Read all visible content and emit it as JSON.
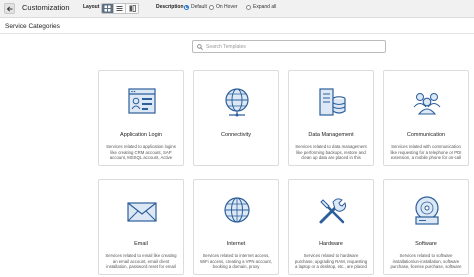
{
  "header": {
    "back_icon": "arrow-left-icon",
    "title": "Customization",
    "layout_label": "Layout",
    "layout_options": [
      {
        "icon": "grid-icon",
        "active": true
      },
      {
        "icon": "list-icon",
        "active": false
      },
      {
        "icon": "split-view-icon",
        "active": false
      }
    ],
    "description_label": "Description",
    "description_options": [
      {
        "label": "Default",
        "checked": true
      },
      {
        "label": "On Hover",
        "checked": false
      },
      {
        "label": "Expand all",
        "checked": false
      }
    ]
  },
  "section_title": "Service Categories",
  "search": {
    "placeholder": "Search Templates",
    "value": ""
  },
  "categories": [
    {
      "name": "Application Login",
      "icon": "application-window-icon",
      "description": "Services related to application logins like creating CRM account, SAP account, MSSQL account, Active"
    },
    {
      "name": "Connectivity",
      "icon": "globe-network-icon",
      "description": ""
    },
    {
      "name": "Data Management",
      "icon": "server-database-icon",
      "description": "Services related to data management like performing backups, restore and clean up data are placed in this"
    },
    {
      "name": "Communication",
      "icon": "people-group-icon",
      "description": "Services related with communication like requesting for a telephone or PDI extension, a mobile phone for on-call"
    },
    {
      "name": "Email",
      "icon": "envelope-icon",
      "description": "Services related to email like creating an email account, email client installation, password reset for email"
    },
    {
      "name": "Internet",
      "icon": "globe-icon",
      "description": "Services related to internet access, WiFi access, creating a VPN account, booking a domain, proxy"
    },
    {
      "name": "Hardware",
      "icon": "tools-icon",
      "description": "Services related to hardware purchase, upgrading RAM, requesting a laptop or a desktop, etc., are placed"
    },
    {
      "name": "Software",
      "icon": "disc-software-icon",
      "description": "Services related to software installation/un-installation, software purchase, license purchase, software"
    }
  ],
  "colors": {
    "accent": "#1d6fd1",
    "icon_blue": "#2d5f9a",
    "icon_light": "#dce8f5",
    "topbar_bg": "#f1f1f1",
    "layout_active": "#5d6f82"
  }
}
